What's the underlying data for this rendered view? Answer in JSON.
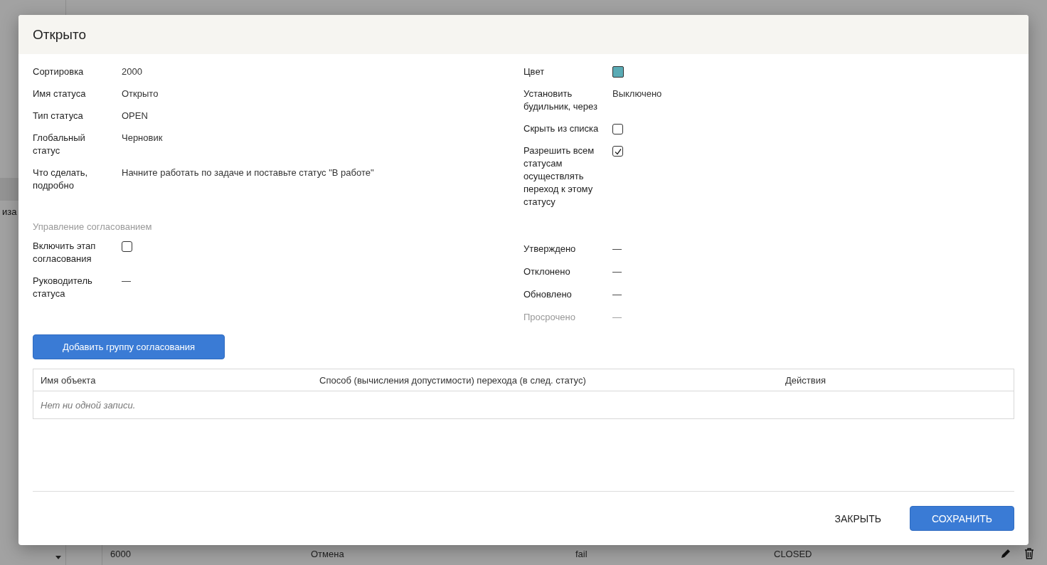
{
  "background": {
    "sidebar_text": "иза",
    "row": {
      "cells": [
        "6000",
        "Отмена",
        "fail",
        "CLOSED"
      ]
    }
  },
  "dialog": {
    "title": "Открыто",
    "left_fields": [
      {
        "label": "Сортировка",
        "value": "2000"
      },
      {
        "label": "Имя статуса",
        "value": "Открыто"
      },
      {
        "label": "Тип статуса",
        "value": "OPEN"
      },
      {
        "label": "Глобальный статус",
        "value": "Черновик"
      },
      {
        "label": "Что сделать, подробно",
        "value": "Начните работать по задаче и поставьте статус \"В работе\""
      }
    ],
    "right_fields": [
      {
        "kind": "color",
        "label": "Цвет",
        "color": "#5aabb5"
      },
      {
        "kind": "text",
        "label": "Установить будильник, через",
        "value": "Выключено"
      },
      {
        "kind": "checkbox",
        "label": "Скрыть из списка",
        "checked": false
      },
      {
        "kind": "checkbox",
        "label": "Разрешить всем статусам осуществлять переход к этому статусу",
        "checked": true
      }
    ],
    "approval": {
      "heading": "Управление согласованием",
      "left_fields": [
        {
          "kind": "checkbox",
          "label": "Включить этап согласования",
          "checked": false
        },
        {
          "kind": "text",
          "label": "Руководитель статуса",
          "value": "—"
        }
      ],
      "right_fields": [
        {
          "label": "Утверждено",
          "value": "—",
          "disabled": false
        },
        {
          "label": "Отклонено",
          "value": "—",
          "disabled": false
        },
        {
          "label": "Обновлено",
          "value": "—",
          "disabled": false
        },
        {
          "label": "Просрочено",
          "value": "—",
          "disabled": true
        }
      ]
    },
    "add_button": "Добавить группу согласования",
    "table": {
      "columns": [
        "Имя объекта",
        "Способ (вычисления допустимости) перехода (в след. статус)",
        "Действия"
      ],
      "empty_text": "Нет ни одной записи."
    },
    "buttons": [
      {
        "kind": "text",
        "label": "ЗАКРЫТЬ"
      },
      {
        "kind": "primary",
        "label": "СОХРАНИТЬ"
      }
    ]
  }
}
